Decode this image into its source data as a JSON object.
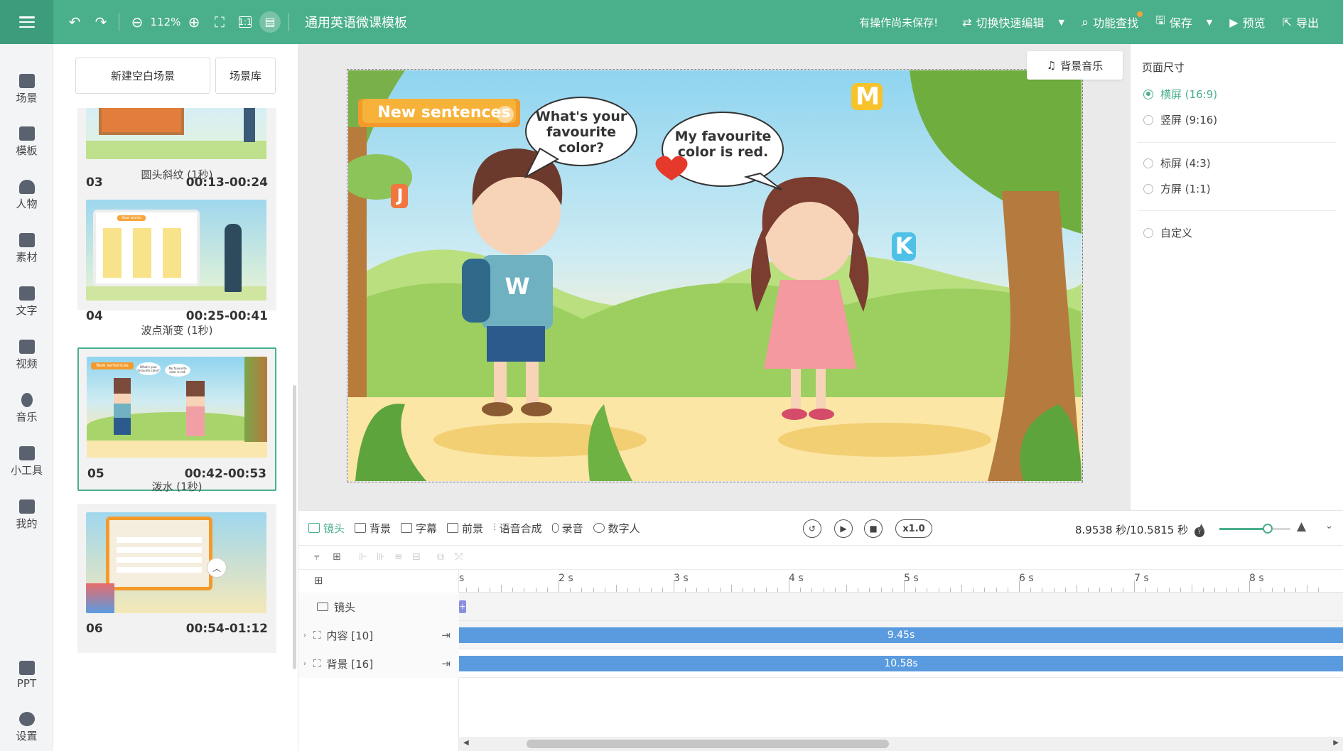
{
  "topbar": {
    "zoom": "112%",
    "title": "通用英语微课模板",
    "unsaved": "有操作尚未保存!",
    "quick_edit": "切换快速编辑",
    "feature_search": "功能查找",
    "save": "保存",
    "preview": "预览",
    "export": "导出"
  },
  "leftnav": {
    "items": [
      {
        "label": "场景",
        "icon": "scene-icon"
      },
      {
        "label": "模板",
        "icon": "template-icon"
      },
      {
        "label": "人物",
        "icon": "person-icon"
      },
      {
        "label": "素材",
        "icon": "asset-icon"
      },
      {
        "label": "文字",
        "icon": "text-icon"
      },
      {
        "label": "视频",
        "icon": "video-icon"
      },
      {
        "label": "音乐",
        "icon": "music-icon"
      },
      {
        "label": "小工具",
        "icon": "toolbox-icon"
      },
      {
        "label": "我的",
        "icon": "upload-icon"
      }
    ],
    "bottom": [
      {
        "label": "PPT",
        "icon": "ppt-icon"
      },
      {
        "label": "设置",
        "icon": "gear-icon"
      }
    ]
  },
  "scenes": {
    "new_blank": "新建空白场景",
    "library": "场景库",
    "cards": [
      {
        "num": "03",
        "time": "00:13-00:24"
      },
      {
        "num": "04",
        "time": "00:25-00:41"
      },
      {
        "num": "05",
        "time": "00:42-00:53"
      },
      {
        "num": "06",
        "time": "00:54-01:12"
      }
    ],
    "transitions": [
      "圆头斜纹 (1秒)",
      "波点渐变 (1秒)",
      "泼水 (1秒)"
    ],
    "thumb_texts": {
      "new_words": "New words",
      "new_sentences": "New sentences",
      "q": "What's your favourite color?",
      "a": "My favourite color is red."
    }
  },
  "canvas": {
    "bgm": "背景音乐",
    "banner": "New sentences",
    "bubble1": "What's your favourite color?",
    "bubble2": "My favourite color is red.",
    "letters": {
      "j": "J",
      "m": "M",
      "k": "K",
      "w": "W"
    }
  },
  "props": {
    "title": "页面尺寸",
    "options": [
      {
        "label": "横屏 (16:9)",
        "selected": true
      },
      {
        "label": "竖屏 (9:16)",
        "selected": false
      },
      {
        "label": "标屏 (4:3)",
        "selected": false
      },
      {
        "label": "方屏 (1:1)",
        "selected": false
      },
      {
        "label": "自定义",
        "selected": false
      }
    ]
  },
  "timeline": {
    "tabs": [
      "镜头",
      "背景",
      "字幕",
      "前景",
      "语音合成",
      "录音",
      "数字人"
    ],
    "speed": "x1.0",
    "time": "8.9538 秒/10.5815 秒",
    "zoom_level": 0.68,
    "ruler": [
      "s",
      "2 s",
      "3 s",
      "4 s",
      "5 s",
      "6 s",
      "7 s",
      "8 s"
    ],
    "rows": [
      {
        "label": "镜头",
        "clip": ""
      },
      {
        "label": "内容 [10]",
        "clip": "9.45s"
      },
      {
        "label": "背景 [16]",
        "clip": "10.58s"
      }
    ]
  },
  "colors": {
    "accent": "#4aaf8b",
    "clip": "#5a9be0"
  }
}
